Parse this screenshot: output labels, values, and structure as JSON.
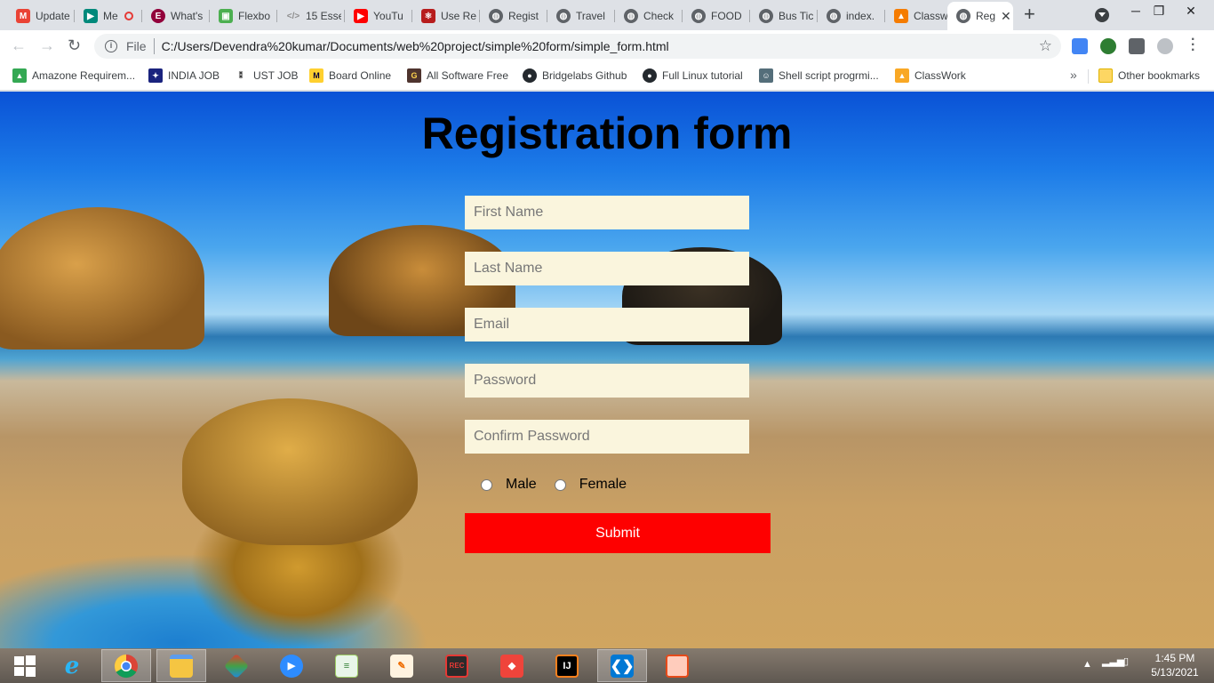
{
  "browser": {
    "tabs": [
      {
        "title": "Update",
        "icon": "gmail-icon",
        "color": "#ea4335"
      },
      {
        "title": "Me",
        "icon": "meet-icon",
        "color": "#00897b"
      },
      {
        "title": "What's",
        "icon": "elementor-icon",
        "color": "#92003b"
      },
      {
        "title": "Flexbo",
        "icon": "flexbox-icon",
        "color": "#4caf50"
      },
      {
        "title": "15 Esse",
        "icon": "code-icon",
        "color": "#8e8e8e"
      },
      {
        "title": "YouTu",
        "icon": "youtube-icon",
        "color": "#ff0000"
      },
      {
        "title": "Use Re",
        "icon": "react-icon",
        "color": "#b71c1c"
      },
      {
        "title": "Regist",
        "icon": "globe-icon",
        "color": "#5f6368"
      },
      {
        "title": "Travel",
        "icon": "globe-icon",
        "color": "#5f6368"
      },
      {
        "title": "Check",
        "icon": "globe-icon",
        "color": "#5f6368"
      },
      {
        "title": "FOOD",
        "icon": "globe-icon",
        "color": "#5f6368"
      },
      {
        "title": "Bus Tic",
        "icon": "globe-icon",
        "color": "#5f6368"
      },
      {
        "title": "index.",
        "icon": "globe-icon",
        "color": "#5f6368"
      },
      {
        "title": "Classw",
        "icon": "classroom-icon",
        "color": "#f57c00"
      }
    ],
    "active_tab": {
      "title": "Reg",
      "icon": "globe-icon"
    },
    "address": {
      "scheme_label": "File",
      "url": "C:/Users/Devendra%20kumar/Documents/web%20project/simple%20form/simple_form.html"
    },
    "bookmarks": [
      {
        "label": "Amazone Requirem...",
        "icon": "drive-icon",
        "color": "#34a853"
      },
      {
        "label": "INDIA JOB",
        "icon": "indiajob-icon",
        "color": "#1a237e"
      },
      {
        "label": "UST JOB",
        "icon": "ust-icon",
        "color": "#333333"
      },
      {
        "label": "Board Online",
        "icon": "miro-icon",
        "color": "#ffd02f"
      },
      {
        "label": "All Software Free",
        "icon": "g-icon",
        "color": "#4e342e"
      },
      {
        "label": "Bridgelabs Github",
        "icon": "github-icon",
        "color": "#24292e"
      },
      {
        "label": "Full Linux tutorial",
        "icon": "github-icon",
        "color": "#24292e"
      },
      {
        "label": "Shell script progrmi...",
        "icon": "person-icon",
        "color": "#546e7a"
      },
      {
        "label": "ClassWork",
        "icon": "classroom-icon",
        "color": "#f9a825"
      }
    ],
    "other_bookmarks": "Other bookmarks"
  },
  "form": {
    "heading": "Registration form",
    "fields": [
      {
        "name": "first-name-input",
        "placeholder": "First Name"
      },
      {
        "name": "last-name-input",
        "placeholder": "Last Name"
      },
      {
        "name": "email-input",
        "placeholder": "Email"
      },
      {
        "name": "password-input",
        "placeholder": "Password"
      },
      {
        "name": "confirm-password-input",
        "placeholder": "Confirm Password"
      }
    ],
    "gender": {
      "male": "Male",
      "female": "Female"
    },
    "submit_label": "Submit",
    "colors": {
      "field_bg": "#faf5dd",
      "submit_bg": "#fe0000"
    }
  },
  "taskbar": {
    "apps": [
      "windows-start-icon",
      "internet-explorer-icon",
      "chrome-icon",
      "file-explorer-icon",
      "git-icon",
      "zoom-icon",
      "notepad-icon",
      "paint-icon",
      "screen-recorder-icon",
      "anydesk-icon",
      "intellij-icon",
      "vscode-icon",
      "presentation-icon"
    ],
    "time": "1:45 PM",
    "date": "5/13/2021"
  }
}
